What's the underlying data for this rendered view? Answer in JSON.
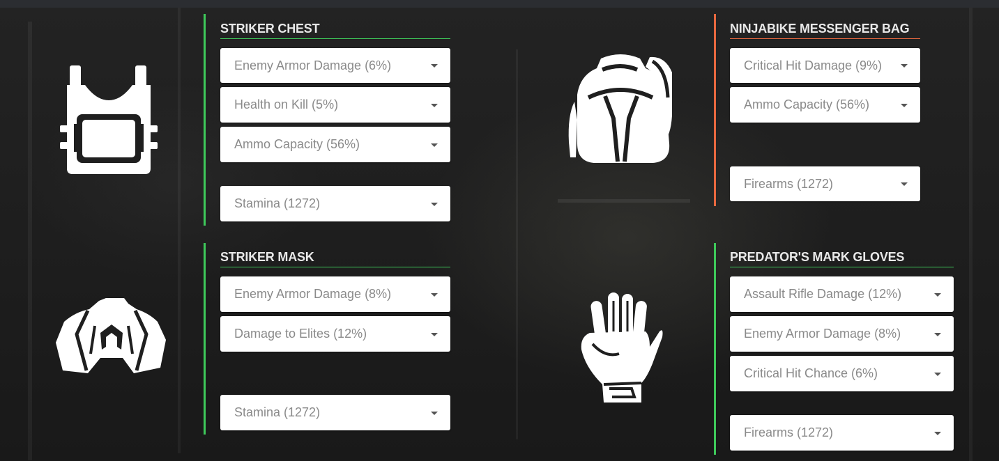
{
  "colors": {
    "green_accent": "#3ec95a",
    "orange_accent": "#e8683f",
    "icon": "#ffffff"
  },
  "chest": {
    "title": "STRIKER CHEST",
    "icon": "vest-icon",
    "slots": [
      "Enemy Armor Damage (6%)",
      "Health on Kill (5%)",
      "Ammo Capacity (56%)",
      "Stamina (1272)"
    ]
  },
  "backpack": {
    "title": "NINJABIKE MESSENGER BAG",
    "icon": "backpack-icon",
    "slots": [
      "Critical Hit Damage (9%)",
      "Ammo Capacity (56%)",
      "Firearms (1272)"
    ]
  },
  "mask": {
    "title": "STRIKER MASK",
    "icon": "mask-icon",
    "slots": [
      "Enemy Armor Damage (8%)",
      "Damage to Elites (12%)",
      "Stamina (1272)"
    ]
  },
  "gloves": {
    "title": "PREDATOR'S MARK GLOVES",
    "icon": "glove-icon",
    "slots": [
      "Assault Rifle Damage (12%)",
      "Enemy Armor Damage (8%)",
      "Critical Hit Chance (6%)",
      "Firearms (1272)"
    ]
  }
}
